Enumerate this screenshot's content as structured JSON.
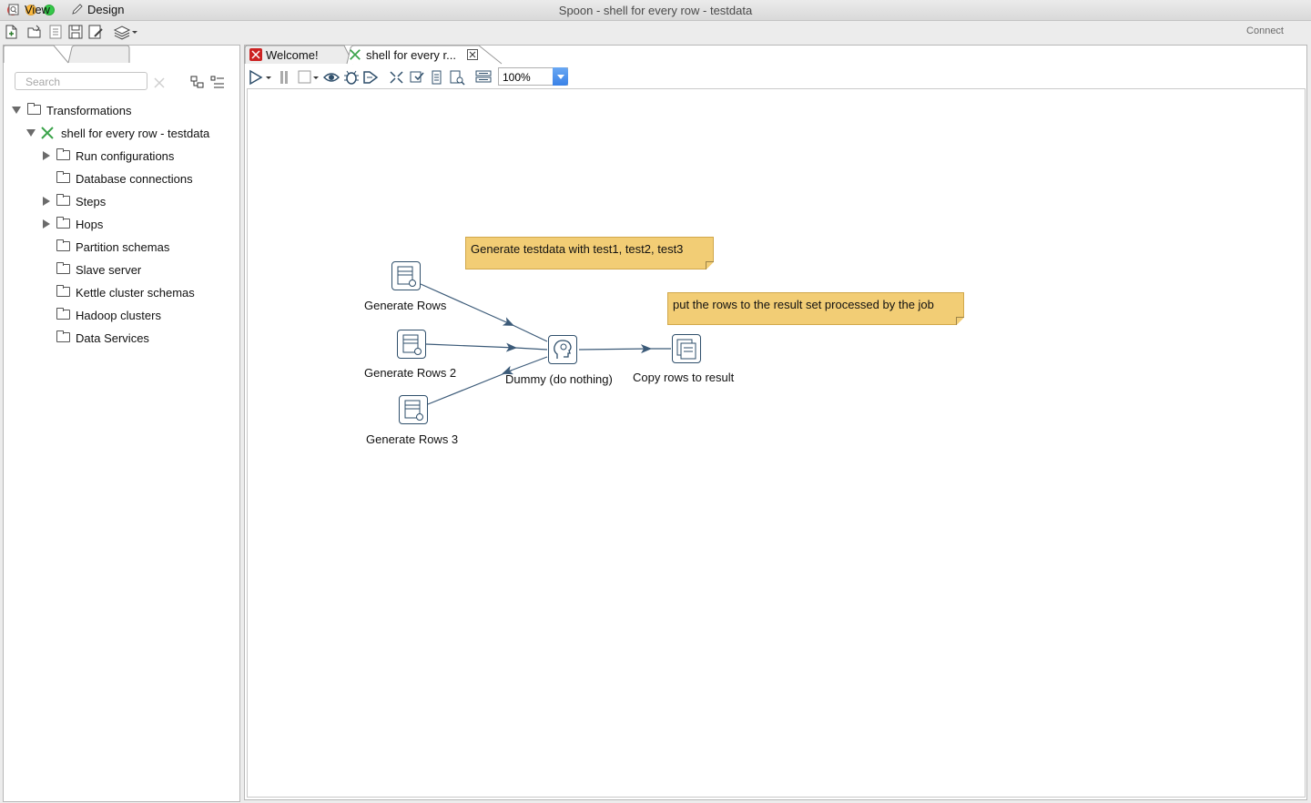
{
  "window": {
    "title": "Spoon - shell for every row - testdata"
  },
  "toolbar": {
    "connect_label": "Connect"
  },
  "left_tabs": {
    "view": "View",
    "design": "Design"
  },
  "search": {
    "placeholder": "Search"
  },
  "tree": {
    "root": "Transformations",
    "transformation": "shell for every row - testdata",
    "items": [
      "Run configurations",
      "Database connections",
      "Steps",
      "Hops",
      "Partition schemas",
      "Slave server",
      "Kettle cluster schemas",
      "Hadoop clusters",
      "Data Services"
    ]
  },
  "editor_tabs": {
    "welcome": "Welcome!",
    "active": "shell for every r..."
  },
  "zoom": {
    "value": "100%"
  },
  "canvas": {
    "steps": {
      "gen1": "Generate Rows",
      "gen2": "Generate Rows 2",
      "gen3": "Generate Rows 3",
      "dummy": "Dummy (do nothing)",
      "copy": "Copy rows to result"
    },
    "notes": {
      "note1": "Generate testdata with test1, test2, test3",
      "note2": "put the rows to the result set processed by the job"
    }
  }
}
